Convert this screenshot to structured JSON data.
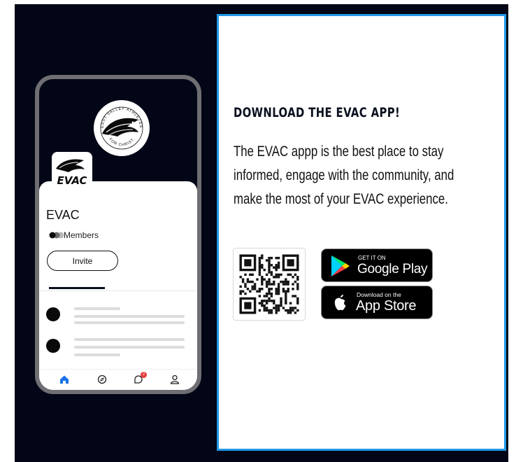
{
  "section": {
    "heading": "DOWNLOAD THE EVAC APP!",
    "description_lines": [
      "The EVAC appp is the best place to stay",
      "informed, engage with the community, and",
      "make the most of your EVAC experience."
    ]
  },
  "stores": {
    "google": {
      "small": "GET IT ON",
      "big": "Google Play"
    },
    "apple": {
      "small": "Download on the",
      "big": "App Store"
    }
  },
  "phone": {
    "emblem_top_text": "EAST VALLEY ATHLETES",
    "emblem_bottom_text": "FOR CHRIST",
    "logo_text": "EVAC",
    "group_name": "EVAC",
    "members_label": "Members",
    "invite_label": "Invite",
    "notification_count": "2",
    "nav_icons": [
      "home-icon",
      "compass-icon",
      "chat-icon",
      "profile-icon"
    ]
  },
  "colors": {
    "navy": "#020616",
    "accent_blue": "#2199e8",
    "nav_active": "#1a73e8"
  }
}
